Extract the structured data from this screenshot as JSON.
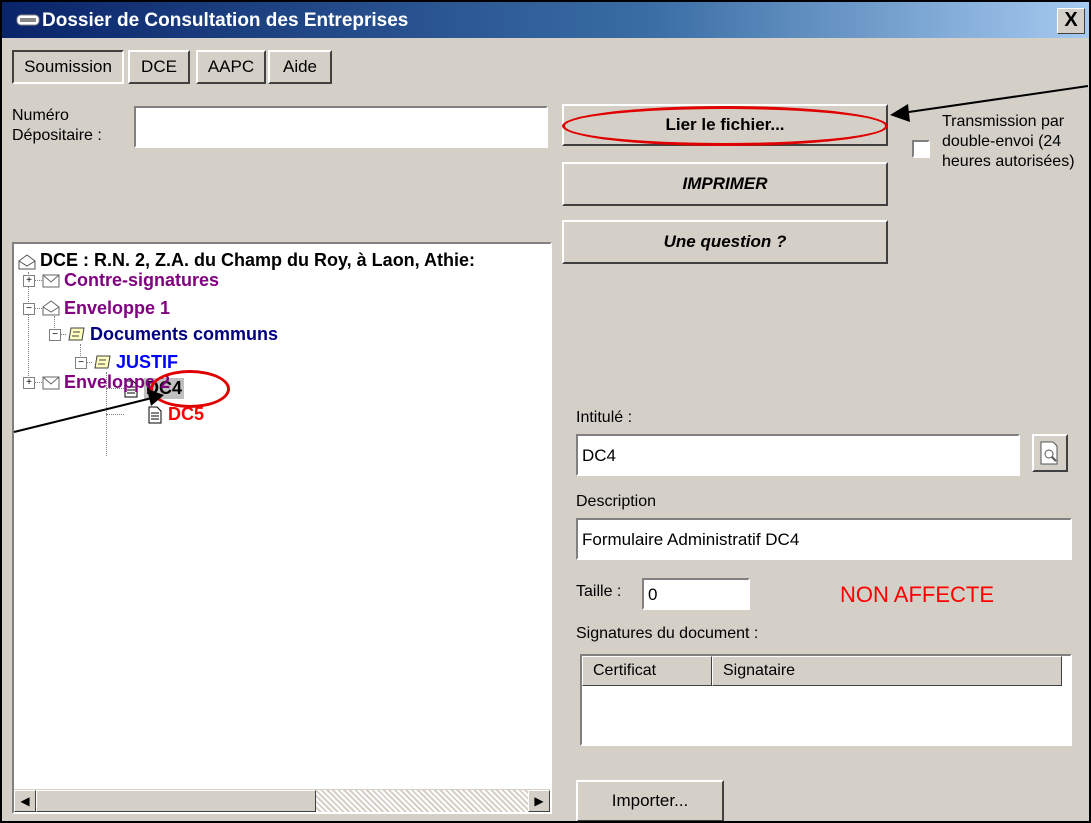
{
  "window": {
    "title": "Dossier de Consultation des Entreprises",
    "close": "X"
  },
  "tabs": [
    {
      "label": "Soumission",
      "active": true
    },
    {
      "label": "DCE"
    },
    {
      "label": "AAPC"
    },
    {
      "label": "Aide"
    }
  ],
  "depositaire": {
    "label_line1": "Numéro",
    "label_line2": "Dépositaire :",
    "value": ""
  },
  "buttons": {
    "lier": "Lier le fichier...",
    "imprimer": "IMPRIMER",
    "question": "Une question ?",
    "importer": "Importer..."
  },
  "transmission": {
    "line1": "Transmission par",
    "line2": "double-envoi (24",
    "line3": "heures autorisées)",
    "checked": false
  },
  "tree": {
    "root": "DCE : R.N. 2, Z.A. du Champ du Roy, à Laon, Athie:",
    "contre_signatures": "Contre-signatures",
    "enveloppe1": "Enveloppe 1",
    "documents_communs": "Documents communs",
    "justif": "JUSTIF",
    "dc4": "DC4",
    "dc5": "DC5",
    "enveloppe2": "Enveloppe 2",
    "colors": {
      "purple": "#800080",
      "navy": "#000080",
      "blue": "#0000ff",
      "red": "#ff0000"
    }
  },
  "details": {
    "intitule_label": "Intitulé :",
    "intitule_value": "DC4",
    "description_label": "Description",
    "description_value": "Formulaire Administratif DC4",
    "taille_label": "Taille :",
    "taille_value": "0",
    "status": "NON AFFECTE",
    "status_color": "#ff0000",
    "signatures_label": "Signatures du document :",
    "columns": [
      "Certificat",
      "Signataire"
    ]
  }
}
